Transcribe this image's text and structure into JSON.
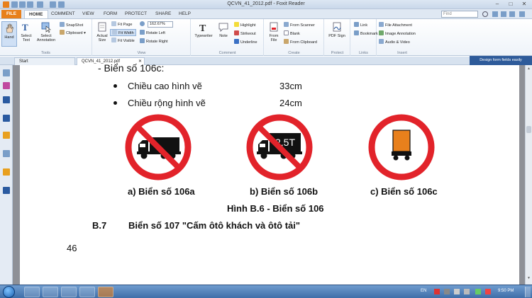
{
  "window": {
    "title": "QCVN_41_2012.pdf - Foxit Reader",
    "minimize_icon": "minimize-icon",
    "maximize_icon": "maximize-icon",
    "close_icon": "close-icon"
  },
  "menu_tabs": [
    "FILE",
    "HOME",
    "COMMENT",
    "VIEW",
    "FORM",
    "PROTECT",
    "SHARE",
    "HELP"
  ],
  "find": {
    "placeholder": "Find"
  },
  "ribbon": {
    "tools": {
      "label": "Tools",
      "hand": "Hand",
      "select_text": "Select Text",
      "select_annotation": "Select Annotation",
      "snapshot": "SnapShot",
      "clipboard": "Clipboard"
    },
    "view": {
      "label": "View",
      "actual_size": "Actual Size",
      "fit_page": "Fit Page",
      "fit_width": "Fit Width",
      "fit_visible": "Fit Visible",
      "zoom": "162.67%",
      "rotate_left": "Rotate Left",
      "rotate_right": "Rotate Right"
    },
    "comment": {
      "label": "Comment",
      "typewriter": "Typewriter",
      "note": "Note",
      "highlight": "Highlight",
      "strikeout": "Strikeout",
      "underline": "Underline"
    },
    "create": {
      "label": "Create",
      "from_file": "From File",
      "from_scanner": "From Scanner",
      "blank": "Blank",
      "from_clipboard": "From Clipboard"
    },
    "protect": {
      "label": "Protect",
      "pdf_sign": "PDF Sign"
    },
    "links": {
      "label": "Links",
      "link": "Link",
      "bookmark": "Bookmark"
    },
    "insert": {
      "label": "Insert",
      "file_attachment": "File Attachment",
      "image_annotation": "Image Annotation",
      "audio_video": "Audio & Video"
    }
  },
  "doc_tabs": [
    "Start",
    "QCVN_41_2012.pdf"
  ],
  "sign_banner": "Design form fields easily",
  "document": {
    "heading_partial": "- Biển số 106c:",
    "bullets": [
      {
        "label": "Chiều cao hình vẽ",
        "value": "33cm"
      },
      {
        "label": "Chiều rộng hình vẽ",
        "value": "24cm"
      }
    ],
    "sign_b_text": "2,5T",
    "captions": [
      "a) Biển số 106a",
      "b) Biển số 106b",
      "c) Biển số 106c"
    ],
    "figure_caption": "Hình B.6 - Biển số 106",
    "section_number": "B.7",
    "section_title": "Biển số 107 \"Cấm ôtô khách và ôtô tải\"",
    "page_number": "46"
  },
  "colors": {
    "sign_red": "#e2232a",
    "orange_box": "#e8801c",
    "file_tab": "#e8801c",
    "banner": "#2e5b9a"
  },
  "taskbar": {
    "language": "EN",
    "clock": "9:50 PM"
  }
}
